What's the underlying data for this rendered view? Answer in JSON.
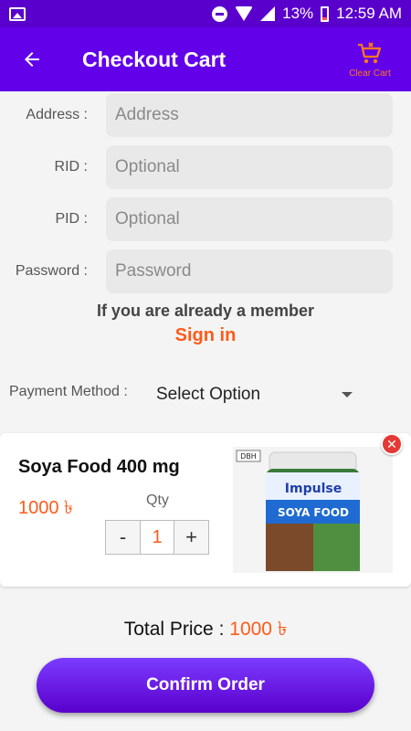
{
  "status_bar": {
    "battery": "13%",
    "time": "12:59 AM",
    "icons": [
      "image-notification-icon",
      "do-not-disturb-icon",
      "wifi-icon",
      "cell-signal-icon",
      "battery-icon"
    ]
  },
  "app_bar": {
    "title": "Checkout Cart",
    "back_icon": "arrow-left-icon",
    "clear_cart_label": "Clear Cart",
    "clear_cart_icon": "cart-remove-icon",
    "background": "#6200ea",
    "accent": "#ff7a1a"
  },
  "form": {
    "address": {
      "label": "Address :",
      "placeholder": "Address",
      "value": ""
    },
    "rid": {
      "label": "RID :",
      "placeholder": "Optional",
      "value": ""
    },
    "pid": {
      "label": "PID :",
      "placeholder": "Optional",
      "value": ""
    },
    "password": {
      "label": "Password :",
      "placeholder": "Password",
      "value": ""
    }
  },
  "member": {
    "text": "If you are already a member",
    "signin_label": "Sign in"
  },
  "payment": {
    "label": "Payment Method :",
    "selected": "Select Option"
  },
  "cart_item": {
    "name": "Soya Food 400 mg",
    "price": "1000 ৳",
    "qty_label": "Qty",
    "qty_minus": "-",
    "qty_value": "1",
    "qty_plus": "+",
    "remove_icon": "close-icon",
    "image_text": {
      "brand": "Impulse",
      "product": "SOYA FOOD",
      "badge": "DBH"
    }
  },
  "total": {
    "label": "Total Price :",
    "value": "1000 ৳"
  },
  "confirm_label": "Confirm Order",
  "colors": {
    "primary": "#6200ea",
    "price": "#ff5a1a",
    "danger": "#e53935"
  }
}
